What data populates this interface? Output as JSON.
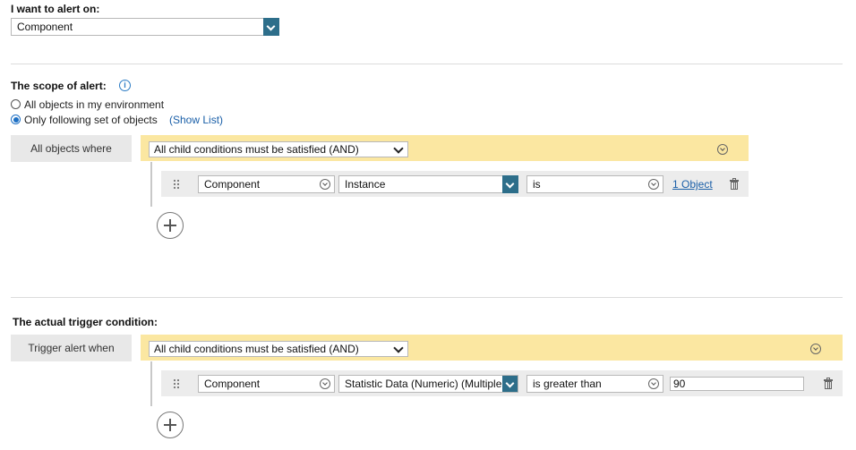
{
  "alert_on": {
    "label": "I want to alert on:",
    "value": "Component"
  },
  "scope": {
    "label": "The scope of alert:",
    "info_icon": "info-icon",
    "options": [
      {
        "label": "All objects in my environment",
        "checked": false
      },
      {
        "label": "Only following set of objects",
        "checked": true
      }
    ],
    "show_list_link": "(Show List)",
    "group_label": "All objects where",
    "operator": "All child conditions must be satisfied (AND)",
    "condition": {
      "field1": "Component",
      "field2": "Instance",
      "field3": "is",
      "value_link": "1 Object"
    }
  },
  "trigger": {
    "label": "The actual trigger condition:",
    "group_label": "Trigger alert when",
    "operator": "All child conditions must be satisfied (AND)",
    "condition": {
      "field1": "Component",
      "field2": "Statistic Data (Numeric) (Multiple",
      "field3": "is greater than",
      "value": "90"
    }
  },
  "colors": {
    "accent_dropdown": "#2d6e8a",
    "condition_bar": "#fbe7a1",
    "link": "#1a5fa8"
  }
}
